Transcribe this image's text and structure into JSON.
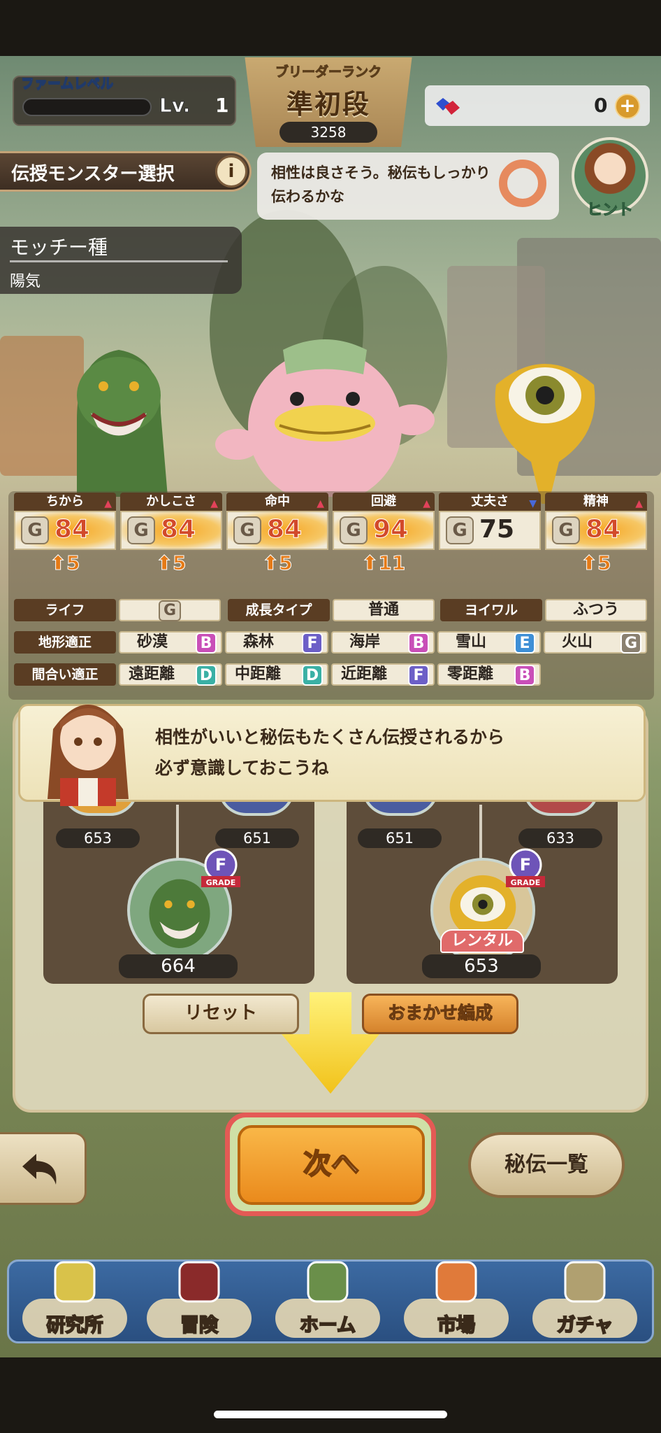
{
  "header": {
    "farm_level_label": "ファームレベル",
    "level_prefix": "Lv.",
    "level_value": "1",
    "farm_progress": 0,
    "rank_label": "ブリーダーランク",
    "rank_name": "準初段",
    "rank_points": "3258",
    "gem_count": "0",
    "gem_plus": "+"
  },
  "selection": {
    "title": "伝授モンスター選択",
    "info_icon": "i",
    "species_name": "モッチー種",
    "species_trait": "陽気"
  },
  "hint": {
    "message": "相性は良さそう。秘伝もしっかり伝わるかな",
    "compatibility_mark": "○",
    "avatar_label": "ヒント"
  },
  "stats": [
    {
      "name": "ちから",
      "grade": "G",
      "value": "84",
      "gain": "5",
      "trend": "up",
      "boost": true
    },
    {
      "name": "かしこさ",
      "grade": "G",
      "value": "84",
      "gain": "5",
      "trend": "up",
      "boost": true
    },
    {
      "name": "命中",
      "grade": "G",
      "value": "84",
      "gain": "5",
      "trend": "up",
      "boost": true
    },
    {
      "name": "回避",
      "grade": "G",
      "value": "94",
      "gain": "11",
      "trend": "up",
      "boost": true
    },
    {
      "name": "丈夫さ",
      "grade": "G",
      "value": "75",
      "gain": "",
      "trend": "down",
      "boost": false
    },
    {
      "name": "精神",
      "grade": "G",
      "value": "84",
      "gain": "5",
      "trend": "up",
      "boost": true
    }
  ],
  "info_row": {
    "life_label": "ライフ",
    "life_value": "G",
    "growth_label": "成長タイプ",
    "growth_value": "普通",
    "yoiwaru_label": "ヨイワル",
    "yoiwaru_value": "ふつう"
  },
  "terrain": {
    "label": "地形適正",
    "items": [
      {
        "name": "砂漠",
        "grade": "B",
        "color": "#c94fb8"
      },
      {
        "name": "森林",
        "grade": "F",
        "color": "#6c5fc7"
      },
      {
        "name": "海岸",
        "grade": "B",
        "color": "#c94fb8"
      },
      {
        "name": "雪山",
        "grade": "E",
        "color": "#3e8fd6"
      },
      {
        "name": "火山",
        "grade": "G",
        "color": "#8a8070"
      }
    ]
  },
  "range": {
    "label": "間合い適正",
    "items": [
      {
        "name": "遠距離",
        "grade": "D",
        "color": "#3ab0a5"
      },
      {
        "name": "中距離",
        "grade": "D",
        "color": "#3ab0a5"
      },
      {
        "name": "近距離",
        "grade": "F",
        "color": "#6c5fc7"
      },
      {
        "name": "零距離",
        "grade": "B",
        "color": "#c94fb8"
      }
    ]
  },
  "dialog": {
    "line1": "相性がいいと秘伝もたくさん伝授されるから",
    "line2": "必ず意識しておこうね"
  },
  "tree_left": {
    "parent1": "653",
    "parent2": "651",
    "main": "664",
    "grade_label": "GRADE",
    "grade_letter": "F"
  },
  "tree_right": {
    "parent1": "651",
    "parent2": "633",
    "main": "653",
    "rental_label": "レンタル",
    "grade_label": "GRADE",
    "grade_letter": "F"
  },
  "buttons": {
    "reset": "リセット",
    "auto": "おまかせ編成",
    "next": "次へ",
    "secret_list": "秘伝一覧"
  },
  "nav": [
    {
      "label": "研究所",
      "icon": "lab-icon"
    },
    {
      "label": "冒険",
      "icon": "book-icon"
    },
    {
      "label": "ホーム",
      "icon": "windmill-icon"
    },
    {
      "label": "市場",
      "icon": "market-icon"
    },
    {
      "label": "ガチャ",
      "icon": "gacha-icon"
    }
  ]
}
